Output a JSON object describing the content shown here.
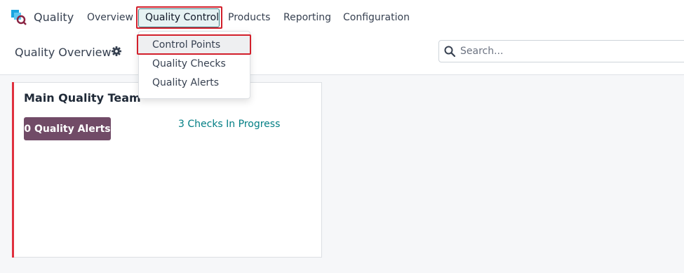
{
  "app": {
    "name": "Quality",
    "icon": "quality-app-logo-icon"
  },
  "nav": {
    "overview": "Overview",
    "quality_control": "Quality Control",
    "products": "Products",
    "reporting": "Reporting",
    "configuration": "Configuration"
  },
  "dropdown": {
    "items": [
      "Control Points",
      "Quality Checks",
      "Quality Alerts"
    ],
    "hovered": "Control Points"
  },
  "control_panel": {
    "title": "Quality Overview",
    "gear_icon": "gear-icon",
    "search_placeholder": "Search..."
  },
  "team_card": {
    "name": "Main Quality Team",
    "alerts_button": "0 Quality Alerts",
    "checks_link": "3 Checks In Progress"
  },
  "colors": {
    "accent": "#714b67",
    "link": "#017e84",
    "highlight": "#d21f2b",
    "card_accent": "#e0303f"
  }
}
